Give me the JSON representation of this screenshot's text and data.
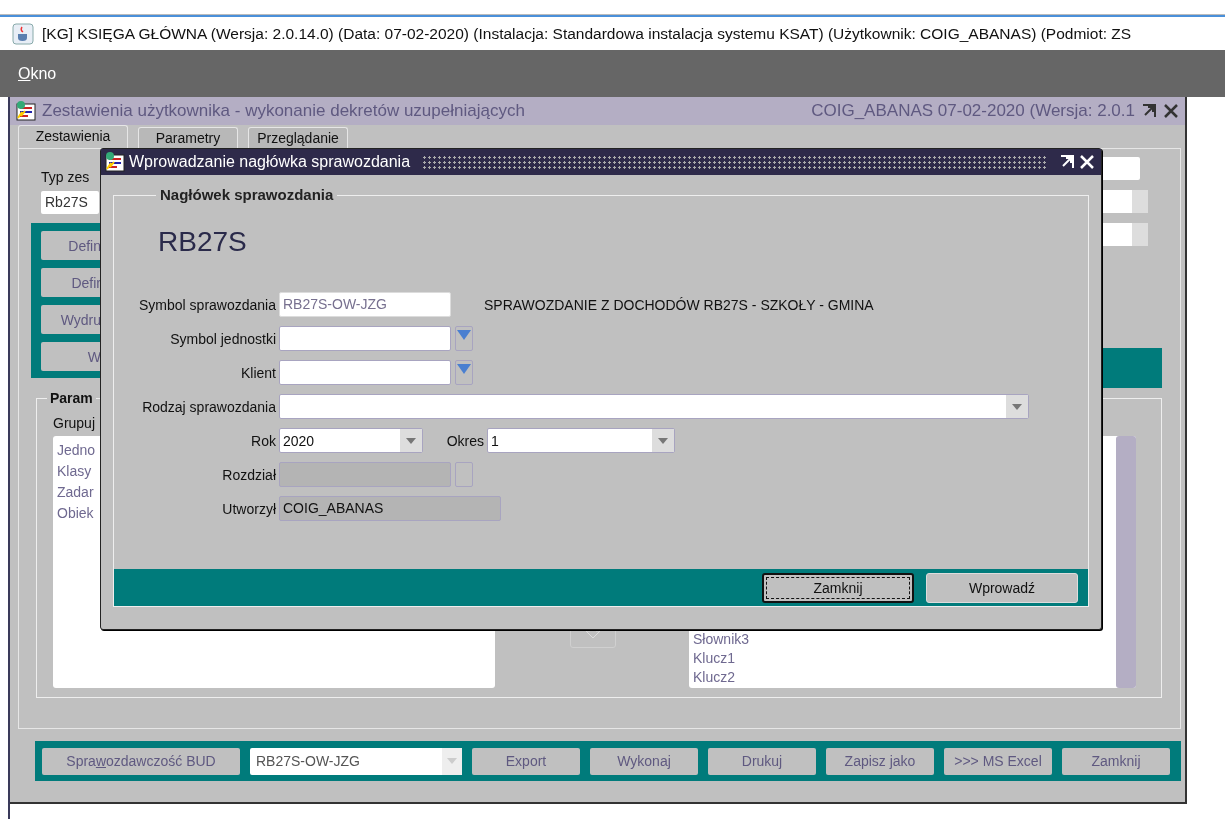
{
  "app_window": {
    "title": "[KG] KSIĘGA GŁÓWNA (Wersja: 2.0.14.0) (Data: 07-02-2020) (Instalacja: Standardowa instalacja systemu KSAT) (Użytkownik: COIG_ABANAS) (Podmiot: ZS"
  },
  "menu": [
    {
      "mnemonic": "O",
      "rest": "kno"
    }
  ],
  "inner_window": {
    "title": "Zestawienia użytkownika - wykonanie dekretów uzupełniających",
    "info": "COIG_ABANAS  07-02-2020  (Wersja: 2.0.1"
  },
  "tabs": [
    {
      "label": "Zestawienia",
      "selected": true
    },
    {
      "label": "Parametry",
      "selected": false
    },
    {
      "label": "Przeglądanie",
      "selected": false
    }
  ],
  "left_panel": {
    "type_label": "Typ zes",
    "type_value": "Rb27S",
    "buttons": [
      "Defin",
      "Defir",
      "Wydru",
      "W"
    ]
  },
  "params": {
    "legend": "Param",
    "group_label": "Grupuj",
    "available": [
      "Jedno",
      "Klasy",
      "Zadar",
      "Obiek"
    ],
    "chosen": [
      "Słownik3",
      "Klucz1",
      "Klucz2"
    ]
  },
  "bottom_toolbar": [
    {
      "kind": "mnemonic_button",
      "before": "Spra",
      "mnemonic": "w",
      "after": "ozdawczość BUD",
      "disabled": true
    },
    {
      "kind": "dropdown",
      "value": "RB27S-OW-JZG",
      "disabled": true
    },
    {
      "kind": "button",
      "label": "Export",
      "disabled": true
    },
    {
      "kind": "button",
      "label": "Wykonaj",
      "disabled": true
    },
    {
      "kind": "button",
      "label": "Drukuj",
      "disabled": true
    },
    {
      "kind": "button",
      "label": "Zapisz jako",
      "disabled": true
    },
    {
      "kind": "button",
      "label": ">>> MS Excel",
      "disabled": true
    },
    {
      "kind": "button",
      "label": "Zamknij",
      "disabled": true
    }
  ],
  "dialog": {
    "title": "Wprowadzanie nagłówka sprawozdania",
    "group_title": "Nagłówek sprawozdania",
    "heading": "RB27S",
    "fields": [
      {
        "kind": "text",
        "label": "Symbol sprawozdania",
        "value": "RB27S-OW-JZG",
        "disabled": false,
        "readonly": true,
        "note": "SPRAWOZDANIE Z DOCHODÓW RB27S - SZKOŁY - GMINA"
      },
      {
        "kind": "lov",
        "label": "Symbol jednostki",
        "disabled": false,
        "readonly": false
      },
      {
        "kind": "lov",
        "label": "Klient",
        "disabled": false,
        "readonly": false
      },
      {
        "kind": "select",
        "label": "Rodzaj sprawozdania"
      },
      {
        "kind": "pair",
        "items": [
          {
            "label": "Rok",
            "value": "2020"
          },
          {
            "label": "Okres",
            "value": "1"
          }
        ]
      },
      {
        "kind": "lov",
        "label": "Rozdział",
        "disabled": true,
        "readonly": false
      },
      {
        "kind": "text",
        "label": "Utworzył",
        "value": "COIG_ABANAS",
        "disabled": true,
        "readonly": false
      }
    ],
    "buttons": [
      {
        "label": "Zamknij",
        "focused": true
      },
      {
        "label": "Wprowadź",
        "focused": false
      }
    ]
  }
}
